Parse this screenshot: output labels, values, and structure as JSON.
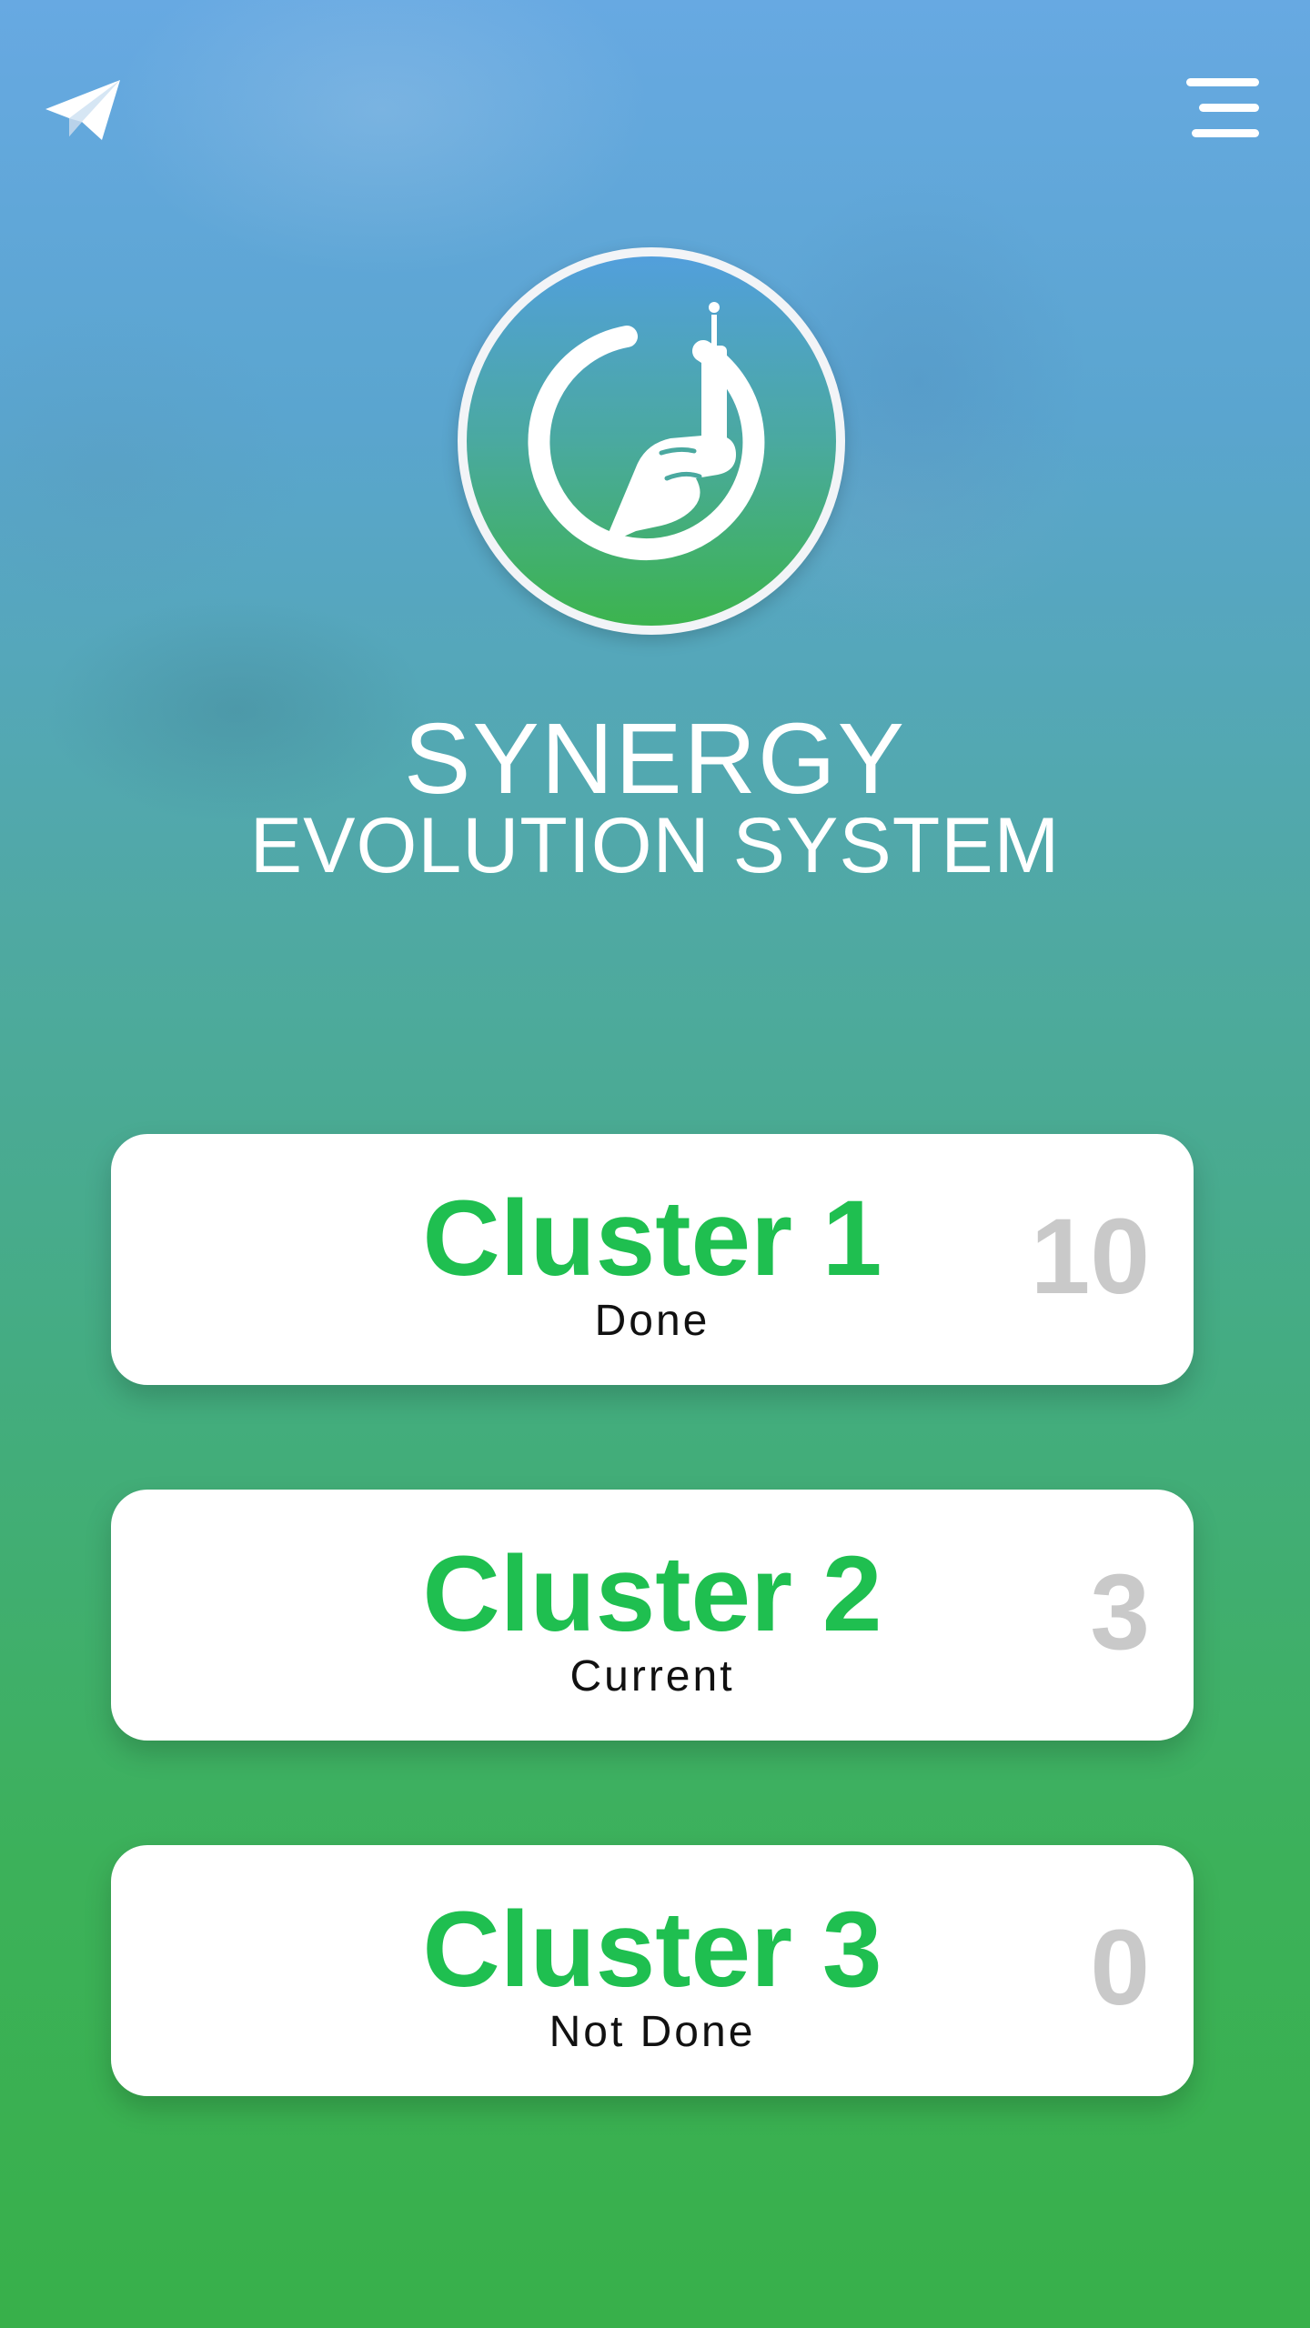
{
  "header": {
    "left_icon": "paper-plane-icon",
    "right_icon": "menu-icon"
  },
  "logo": {
    "icon": "syringe-hand-icon"
  },
  "brand": {
    "title": "SYNERGY",
    "subtitle": "EVOLUTION SYSTEM"
  },
  "clusters": [
    {
      "title": "Cluster 1",
      "status": "Done",
      "count": "10"
    },
    {
      "title": "Cluster 2",
      "status": "Current",
      "count": "3"
    },
    {
      "title": "Cluster 3",
      "status": "Not Done",
      "count": "0"
    }
  ],
  "colors": {
    "accent_green": "#1fbf50",
    "count_gray": "#c9c9c9",
    "bg_top": "#67a9e2",
    "bg_bottom": "#38b04a"
  }
}
